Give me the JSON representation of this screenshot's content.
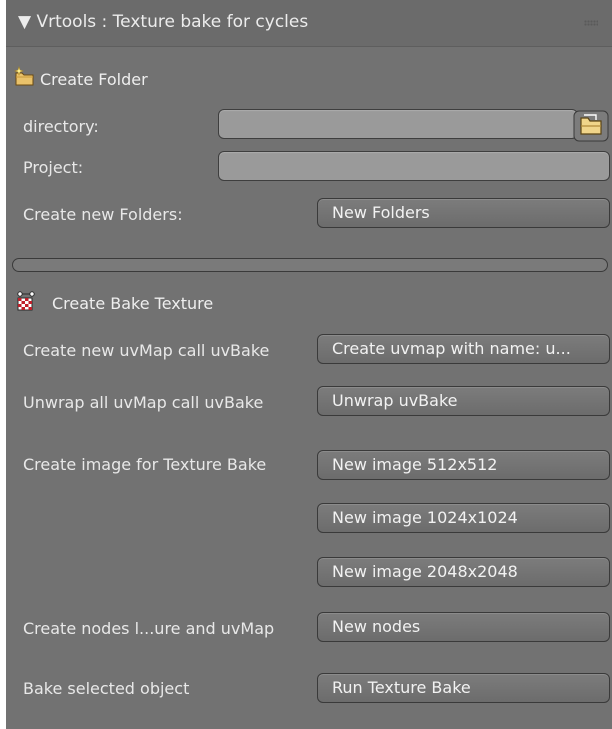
{
  "panel": {
    "title": "Vrtools : Texture bake for cycles",
    "collapse_glyph": "▼"
  },
  "create_folder": {
    "header_label": "Create Folder",
    "header_icon": "new-folder-icon",
    "directory_label": "directory:",
    "directory_value": "",
    "file_browse_icon": "file-browser-icon",
    "project_label": "Project:",
    "project_value": "",
    "new_folders_label": "Create new Folders:",
    "new_folders_button": "New Folders"
  },
  "bake_texture": {
    "header_label": "Create Bake Texture",
    "header_icon": "texture-node-icon",
    "rows": [
      {
        "label": "Create new uvMap call uvBake",
        "button": "Create uvmap with name: u..."
      },
      {
        "label": "Unwrap all uvMap call uvBake",
        "button": "Unwrap uvBake"
      },
      {
        "label": "Create image for Texture Bake",
        "button": "New image 512x512"
      },
      {
        "label": "",
        "button": "New image 1024x1024"
      },
      {
        "label": "",
        "button": "New image 2048x2048"
      },
      {
        "label": "Create nodes l...ure and uvMap",
        "button": "New nodes"
      },
      {
        "label": "Bake selected object",
        "button": "Run Texture Bake"
      }
    ]
  },
  "colors": {
    "panel_bg": "#727272",
    "field_bg": "#9a9a9a",
    "button_bg": "#747474",
    "text": "#e8e8e8"
  }
}
